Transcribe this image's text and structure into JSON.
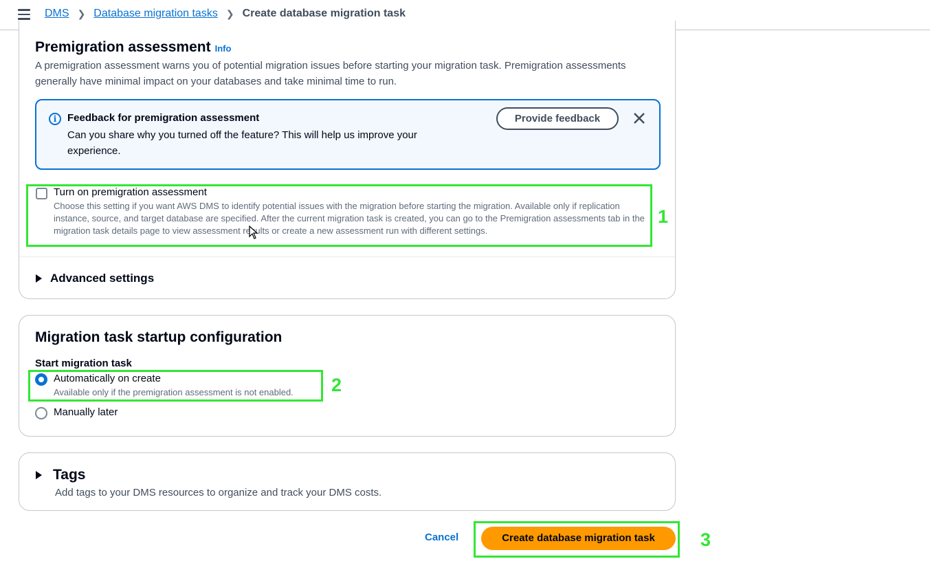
{
  "breadcrumb": {
    "items": [
      "DMS",
      "Database migration tasks"
    ],
    "current": "Create database migration task"
  },
  "premigration": {
    "title": "Premigration assessment",
    "info": "Info",
    "description": "A premigration assessment warns you of potential migration issues before starting your migration task. Premigration assessments generally have minimal impact on your databases and take minimal time to run.",
    "alert": {
      "title": "Feedback for premigration assessment",
      "text": "Can you share why you turned off the feature? This will help us improve your experience.",
      "button": "Provide feedback"
    },
    "checkbox": {
      "label": "Turn on premigration assessment",
      "checked": false,
      "description": "Choose this setting if you want AWS DMS to identify potential issues with the migration before starting the migration. Available only if replication instance, source, and target database are specified. After the current migration task is created, you can go to the Premigration assessments tab in the migration task details page to view assessment results or create a new assessment run with different settings."
    },
    "advanced": "Advanced settings"
  },
  "startup": {
    "title": "Migration task startup configuration",
    "field_label": "Start migration task",
    "options": [
      {
        "label": "Automatically on create",
        "description": "Available only if the premigration assessment is not enabled.",
        "selected": true
      },
      {
        "label": "Manually later",
        "selected": false
      }
    ]
  },
  "tags": {
    "title": "Tags",
    "description": "Add tags to your DMS resources to organize and track your DMS costs."
  },
  "actions": {
    "cancel": "Cancel",
    "create": "Create database migration task"
  },
  "annotations": [
    "1",
    "2",
    "3"
  ],
  "colors": {
    "primary_button": "#ff9900",
    "link": "#0972d3",
    "highlight": "#33e633"
  }
}
